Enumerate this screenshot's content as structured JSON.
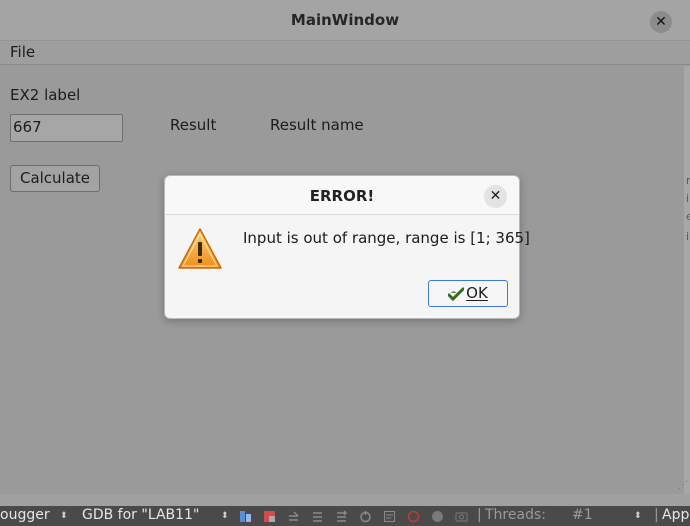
{
  "main_window": {
    "title": "MainWindow",
    "close_glyph": "✕",
    "menu": {
      "file": "File"
    },
    "ex2_label": "EX2 label",
    "input_value": "667",
    "result_label": "Result",
    "result_name": "Result name",
    "calculate_label": "Calculate"
  },
  "dialog": {
    "title": "ERROR!",
    "close_glyph": "✕",
    "message": "Input is out of range, range is [1; 365]",
    "ok_label": "OK",
    "icon": "warning-icon"
  },
  "statusbar": {
    "debugger": "ougger",
    "gdb": "GDB for \"LAB11\"",
    "threads_label": "Threads:",
    "thread_value": "#1",
    "app": "App"
  },
  "colors": {
    "accent": "#3d7ad6",
    "warning_orange": "#f08c1a",
    "dim_overlay": "#9a9a9a"
  }
}
